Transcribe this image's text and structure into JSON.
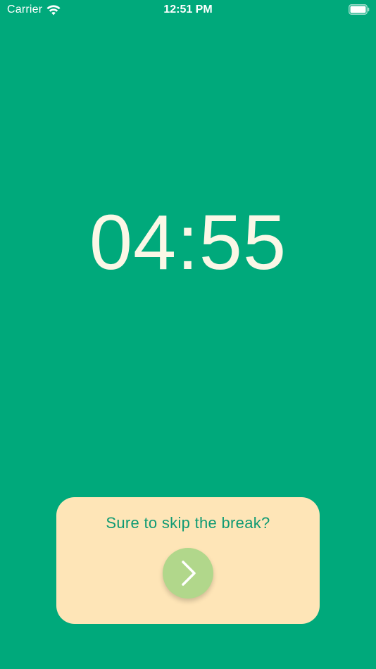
{
  "status_bar": {
    "carrier": "Carrier",
    "time": "12:51 PM",
    "icons": [
      "wifi-icon",
      "battery-icon"
    ]
  },
  "timer": {
    "value": "04:55"
  },
  "skip_prompt": {
    "question": "Sure to skip the break?",
    "button_icon": "chevron-right-icon"
  },
  "colors": {
    "background": "#00a97b",
    "timer_text": "#fbf7e6",
    "card_background": "#fee5b7",
    "card_text": "#0f9a73",
    "button_background": "#b1d78b"
  }
}
